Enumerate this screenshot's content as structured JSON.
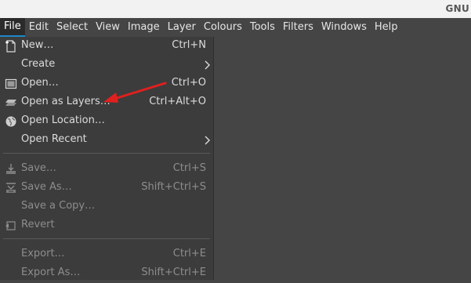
{
  "window": {
    "title": "GNU"
  },
  "menubar": {
    "items": [
      {
        "label": "File",
        "active": true
      },
      {
        "label": "Edit"
      },
      {
        "label": "Select"
      },
      {
        "label": "View"
      },
      {
        "label": "Image"
      },
      {
        "label": "Layer"
      },
      {
        "label": "Colours"
      },
      {
        "label": "Tools"
      },
      {
        "label": "Filters"
      },
      {
        "label": "Windows"
      },
      {
        "label": "Help"
      }
    ]
  },
  "file_menu": {
    "items": [
      {
        "label": "New…",
        "accel": "Ctrl+N",
        "icon": "new-document-icon",
        "enabled": true
      },
      {
        "label": "Create",
        "accel": "",
        "icon": "",
        "enabled": true,
        "submenu": true
      },
      {
        "label": "Open…",
        "accel": "Ctrl+O",
        "icon": "open-image-icon",
        "enabled": true
      },
      {
        "label": "Open as Layers…",
        "accel": "Ctrl+Alt+O",
        "icon": "layers-icon",
        "enabled": true
      },
      {
        "label": "Open Location…",
        "accel": "",
        "icon": "globe-icon",
        "enabled": true
      },
      {
        "label": "Open Recent",
        "accel": "",
        "icon": "",
        "enabled": true,
        "submenu": true
      },
      {
        "label": "Save…",
        "accel": "Ctrl+S",
        "icon": "save-icon",
        "enabled": false
      },
      {
        "label": "Save As…",
        "accel": "Shift+Ctrl+S",
        "icon": "save-as-icon",
        "enabled": false
      },
      {
        "label": "Save a Copy…",
        "accel": "",
        "icon": "",
        "enabled": false
      },
      {
        "label": "Revert",
        "accel": "",
        "icon": "revert-icon",
        "enabled": false
      },
      {
        "label": "Export…",
        "accel": "Ctrl+E",
        "icon": "",
        "enabled": false
      },
      {
        "label": "Export As…",
        "accel": "Shift+Ctrl+E",
        "icon": "",
        "enabled": false
      }
    ]
  },
  "colors": {
    "background": "#454545",
    "menu_background": "#3c3c3c",
    "active_underline": "#1e88c8",
    "annotation_arrow": "#e0201e",
    "disabled_text": "#8d8d8d"
  }
}
